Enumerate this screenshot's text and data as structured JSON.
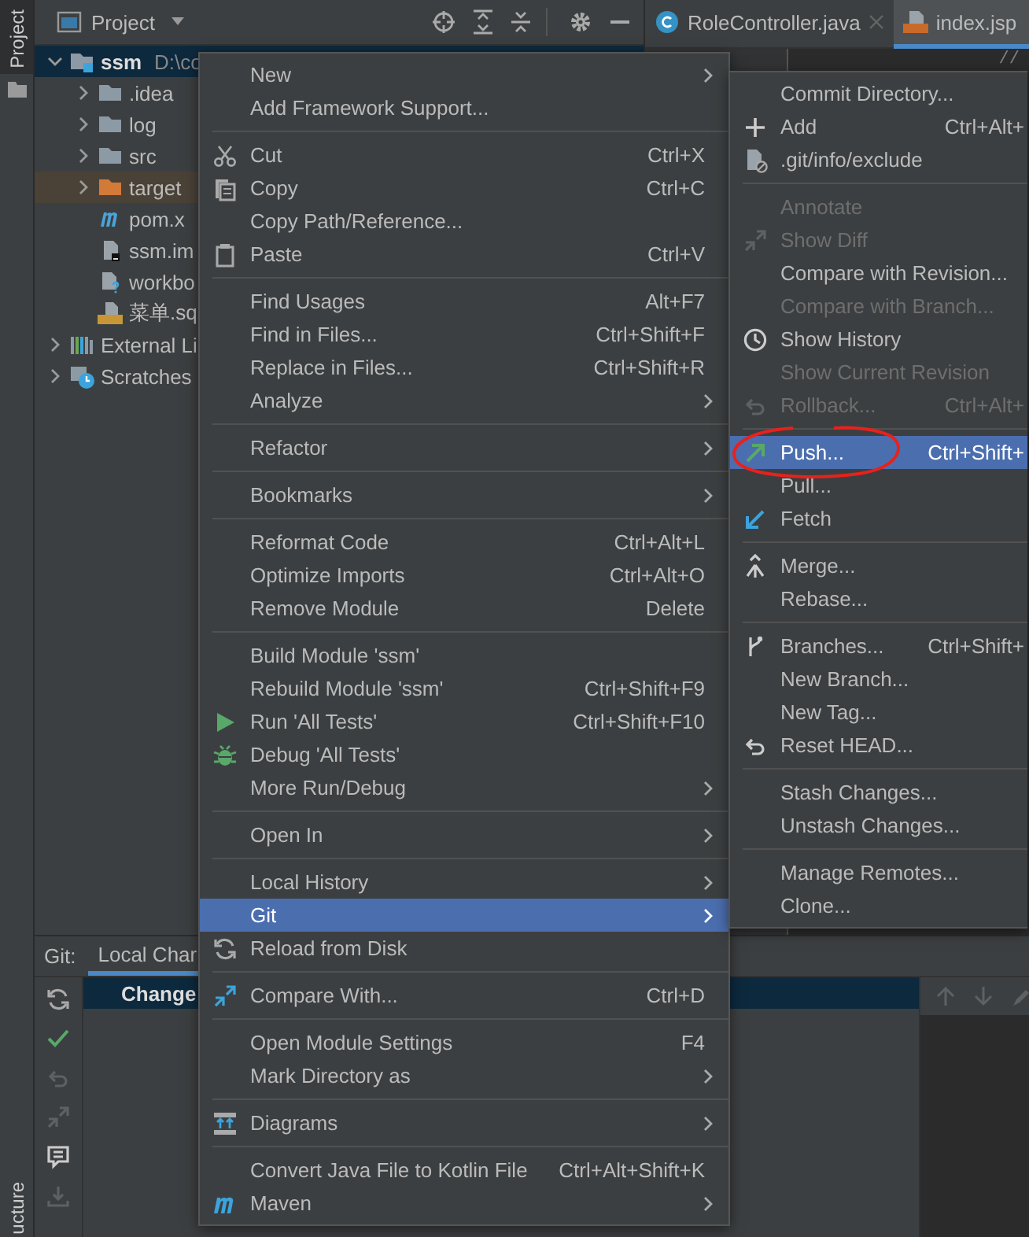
{
  "side_tabs": [
    {
      "label": "Project",
      "selected": true
    },
    {
      "label": "ucture",
      "selected": false
    }
  ],
  "project_panel": {
    "title": "Project"
  },
  "project_tree": [
    {
      "label": "ssm",
      "path": "D:\\co",
      "kind": "module",
      "expanded": true,
      "selected": true,
      "children": [
        {
          "label": ".idea",
          "kind": "folder",
          "expanded": false,
          "selected": false
        },
        {
          "label": "log",
          "kind": "folder",
          "expanded": false,
          "selected": false
        },
        {
          "label": "src",
          "kind": "folder",
          "expanded": false,
          "selected": false
        },
        {
          "label": "target",
          "kind": "excluded-folder",
          "expanded": false,
          "selected": false
        },
        {
          "label": "pom.x",
          "kind": "maven",
          "selected": false
        },
        {
          "label": "ssm.im",
          "kind": "iml",
          "selected": false
        },
        {
          "label": "workbo",
          "kind": "unknown-file",
          "selected": false
        },
        {
          "label": "菜单.sq",
          "kind": "sql",
          "selected": false
        }
      ]
    },
    {
      "label": "External Li",
      "kind": "library",
      "expanded": false,
      "selected": false
    },
    {
      "label": "Scratches",
      "kind": "scratches",
      "expanded": false,
      "selected": false
    }
  ],
  "editor_tabs": [
    {
      "label": "RoleController.java",
      "kind": "java",
      "selected": false
    },
    {
      "label": "index.jsp",
      "kind": "jsp",
      "selected": true
    }
  ],
  "editor": {
    "code": "//"
  },
  "context_menu": [
    {
      "kind": "item",
      "label": "New",
      "submenu": true,
      "selected": false
    },
    {
      "kind": "item",
      "label": "Add Framework Support...",
      "submenu": false,
      "selected": false
    },
    {
      "kind": "separator"
    },
    {
      "kind": "item",
      "label": "Cut",
      "shortcut": "Ctrl+X",
      "submenu": false,
      "selected": false
    },
    {
      "kind": "item",
      "label": "Copy",
      "shortcut": "Ctrl+C",
      "submenu": false,
      "selected": false
    },
    {
      "kind": "item",
      "label": "Copy Path/Reference...",
      "submenu": false,
      "selected": false
    },
    {
      "kind": "item",
      "label": "Paste",
      "shortcut": "Ctrl+V",
      "submenu": false,
      "selected": false
    },
    {
      "kind": "separator"
    },
    {
      "kind": "item",
      "label": "Find Usages",
      "shortcut": "Alt+F7",
      "submenu": false,
      "selected": false
    },
    {
      "kind": "item",
      "label": "Find in Files...",
      "shortcut": "Ctrl+Shift+F",
      "submenu": false,
      "selected": false
    },
    {
      "kind": "item",
      "label": "Replace in Files...",
      "shortcut": "Ctrl+Shift+R",
      "submenu": false,
      "selected": false
    },
    {
      "kind": "item",
      "label": "Analyze",
      "submenu": true,
      "selected": false
    },
    {
      "kind": "separator"
    },
    {
      "kind": "item",
      "label": "Refactor",
      "submenu": true,
      "selected": false
    },
    {
      "kind": "separator"
    },
    {
      "kind": "item",
      "label": "Bookmarks",
      "submenu": true,
      "selected": false
    },
    {
      "kind": "separator"
    },
    {
      "kind": "item",
      "label": "Reformat Code",
      "shortcut": "Ctrl+Alt+L",
      "submenu": false,
      "selected": false
    },
    {
      "kind": "item",
      "label": "Optimize Imports",
      "shortcut": "Ctrl+Alt+O",
      "submenu": false,
      "selected": false
    },
    {
      "kind": "item",
      "label": "Remove Module",
      "shortcut": "Delete",
      "submenu": false,
      "selected": false
    },
    {
      "kind": "separator"
    },
    {
      "kind": "item",
      "label": "Build Module 'ssm'",
      "submenu": false,
      "selected": false
    },
    {
      "kind": "item",
      "label": "Rebuild Module 'ssm'",
      "shortcut": "Ctrl+Shift+F9",
      "submenu": false,
      "selected": false
    },
    {
      "kind": "item",
      "label": "Run 'All Tests'",
      "shortcut": "Ctrl+Shift+F10",
      "submenu": false,
      "selected": false
    },
    {
      "kind": "item",
      "label": "Debug 'All Tests'",
      "submenu": false,
      "selected": false
    },
    {
      "kind": "item",
      "label": "More Run/Debug",
      "submenu": true,
      "selected": false
    },
    {
      "kind": "separator"
    },
    {
      "kind": "item",
      "label": "Open In",
      "submenu": true,
      "selected": false
    },
    {
      "kind": "separator"
    },
    {
      "kind": "item",
      "label": "Local History",
      "submenu": true,
      "selected": false
    },
    {
      "kind": "item",
      "label": "Git",
      "submenu": true,
      "selected": true
    },
    {
      "kind": "item",
      "label": "Reload from Disk",
      "submenu": false,
      "selected": false
    },
    {
      "kind": "separator"
    },
    {
      "kind": "item",
      "label": "Compare With...",
      "shortcut": "Ctrl+D",
      "submenu": false,
      "selected": false
    },
    {
      "kind": "separator"
    },
    {
      "kind": "item",
      "label": "Open Module Settings",
      "shortcut": "F4",
      "submenu": false,
      "selected": false
    },
    {
      "kind": "item",
      "label": "Mark Directory as",
      "submenu": true,
      "selected": false
    },
    {
      "kind": "separator"
    },
    {
      "kind": "item",
      "label": "Diagrams",
      "submenu": true,
      "selected": false
    },
    {
      "kind": "separator"
    },
    {
      "kind": "item",
      "label": "Convert Java File to Kotlin File",
      "shortcut": "Ctrl+Alt+Shift+K",
      "submenu": false,
      "selected": false
    },
    {
      "kind": "item",
      "label": "Maven",
      "submenu": true,
      "selected": false
    }
  ],
  "git_submenu": [
    {
      "kind": "item",
      "label": "Commit Directory...",
      "disabled": false,
      "selected": false
    },
    {
      "kind": "item",
      "label": "Add",
      "shortcut": "Ctrl+Alt+",
      "disabled": false,
      "selected": false
    },
    {
      "kind": "item",
      "label": ".git/info/exclude",
      "disabled": false,
      "selected": false
    },
    {
      "kind": "separator"
    },
    {
      "kind": "item",
      "label": "Annotate",
      "disabled": true,
      "selected": false
    },
    {
      "kind": "item",
      "label": "Show Diff",
      "disabled": true,
      "selected": false
    },
    {
      "kind": "item",
      "label": "Compare with Revision...",
      "disabled": false,
      "selected": false
    },
    {
      "kind": "item",
      "label": "Compare with Branch...",
      "disabled": true,
      "selected": false
    },
    {
      "kind": "item",
      "label": "Show History",
      "disabled": false,
      "selected": false
    },
    {
      "kind": "item",
      "label": "Show Current Revision",
      "disabled": true,
      "selected": false
    },
    {
      "kind": "item",
      "label": "Rollback...",
      "shortcut": "Ctrl+Alt+",
      "disabled": true,
      "selected": false
    },
    {
      "kind": "separator"
    },
    {
      "kind": "item",
      "label": "Push...",
      "shortcut": "Ctrl+Shift+",
      "disabled": false,
      "selected": true
    },
    {
      "kind": "item",
      "label": "Pull...",
      "disabled": false,
      "selected": false
    },
    {
      "kind": "item",
      "label": "Fetch",
      "disabled": false,
      "selected": false
    },
    {
      "kind": "separator"
    },
    {
      "kind": "item",
      "label": "Merge...",
      "disabled": false,
      "selected": false
    },
    {
      "kind": "item",
      "label": "Rebase...",
      "disabled": false,
      "selected": false
    },
    {
      "kind": "separator"
    },
    {
      "kind": "item",
      "label": "Branches...",
      "shortcut": "Ctrl+Shift+",
      "disabled": false,
      "selected": false
    },
    {
      "kind": "item",
      "label": "New Branch...",
      "disabled": false,
      "selected": false
    },
    {
      "kind": "item",
      "label": "New Tag...",
      "disabled": false,
      "selected": false
    },
    {
      "kind": "item",
      "label": "Reset HEAD...",
      "disabled": false,
      "selected": false
    },
    {
      "kind": "separator"
    },
    {
      "kind": "item",
      "label": "Stash Changes...",
      "disabled": false,
      "selected": false
    },
    {
      "kind": "item",
      "label": "Unstash Changes...",
      "disabled": false,
      "selected": false
    },
    {
      "kind": "separator"
    },
    {
      "kind": "item",
      "label": "Manage Remotes...",
      "disabled": false,
      "selected": false
    },
    {
      "kind": "item",
      "label": "Clone...",
      "disabled": false,
      "selected": false
    }
  ],
  "git_panel": {
    "label": "Git:",
    "tabs": [
      {
        "label": "Local Char",
        "selected": true
      }
    ],
    "changes": [
      {
        "label": "Change",
        "selected": true
      }
    ]
  }
}
